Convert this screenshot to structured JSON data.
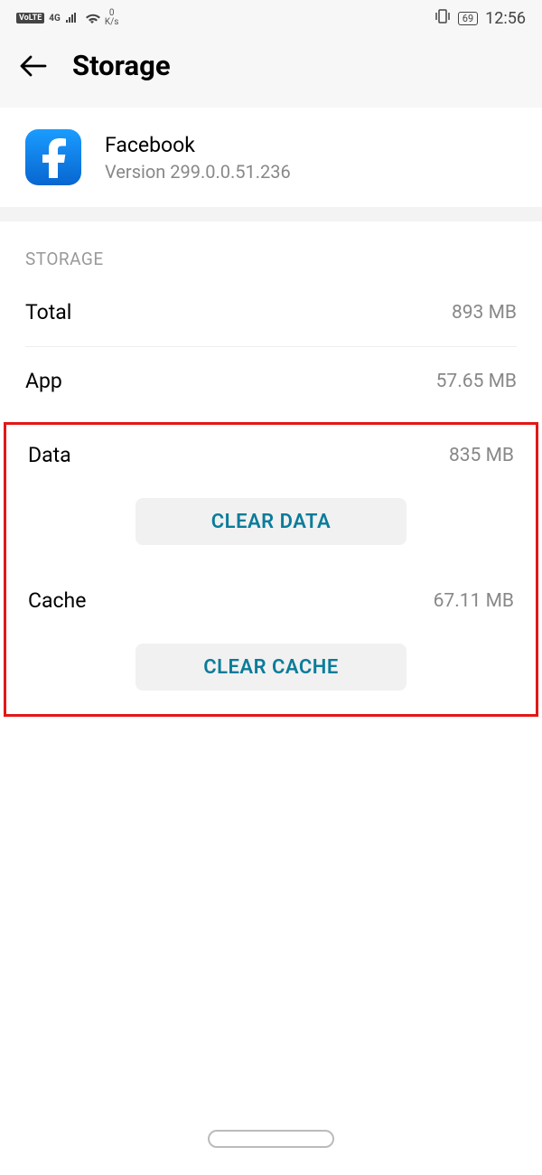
{
  "statusBar": {
    "volte": "VoLTE",
    "network": "4G",
    "netSpeed": "0",
    "netUnit": "K/s",
    "battery": "69",
    "time": "12:56"
  },
  "header": {
    "title": "Storage"
  },
  "app": {
    "name": "Facebook",
    "versionLabel": "Version 299.0.0.51.236"
  },
  "section": {
    "header": "STORAGE"
  },
  "rows": {
    "totalLabel": "Total",
    "totalValue": "893 MB",
    "appLabel": "App",
    "appValue": "57.65 MB",
    "dataLabel": "Data",
    "dataValue": "835 MB",
    "cacheLabel": "Cache",
    "cacheValue": "67.11 MB"
  },
  "buttons": {
    "clearData": "CLEAR DATA",
    "clearCache": "CLEAR CACHE"
  }
}
